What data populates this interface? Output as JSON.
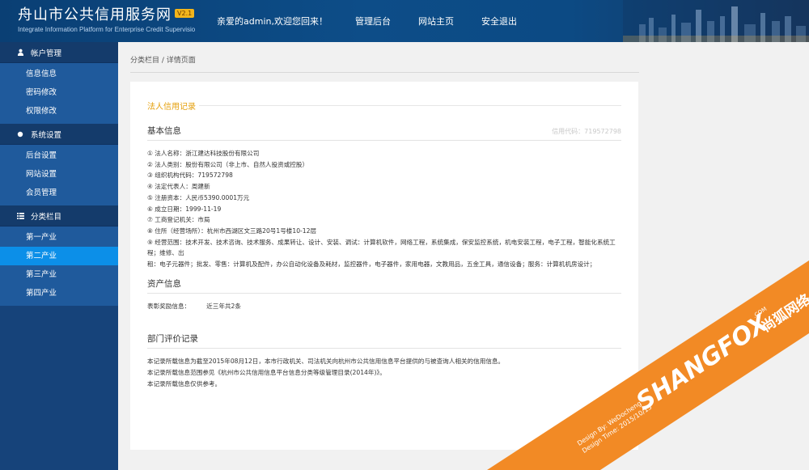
{
  "header": {
    "logo_title": "舟山市公共信用服务网",
    "logo_badge": "V2.1",
    "logo_subtitle": "Integrate Information Platform for Enterprise Credit Supervisio",
    "welcome": "亲爱的admin,欢迎您回来！",
    "nav": [
      "管理后台",
      "网站主页",
      "安全退出"
    ]
  },
  "sidebar": {
    "groups": [
      {
        "label": "帐户管理",
        "icon": "user-icon",
        "items": [
          "信息信息",
          "密码修改",
          "权限修改"
        ]
      },
      {
        "label": "系统设置",
        "icon": "dot-icon",
        "items": [
          "后台设置",
          "网站设置",
          "会员管理"
        ]
      },
      {
        "label": "分类栏目",
        "icon": "list-icon",
        "items": [
          "第一产业",
          "第二产业",
          "第三产业",
          "第四产业"
        ],
        "active_index": 1
      }
    ]
  },
  "breadcrumb": "分类栏目 / 详情页面",
  "record": {
    "title": "法人信用记录",
    "basic_title": "基本信息",
    "credit_code": "信用代码：719572798",
    "basic_rows": [
      "① 法人名称：浙江建达科技股份有限公司",
      "② 法人类别：股份有限公司（非上市、自然人投资或控股）",
      "③ 组织机构代码：719572798",
      "④ 法定代表人：周建新",
      "⑤ 注册资本：人民币5390.0001万元",
      "⑥ 成立日期：1999-11-19",
      "⑦ 工商登记机关：市局",
      "⑧ 住所（经营场所）：杭州市西湖区文三路20号1号楼10-12层",
      "⑨ 经营范围：技术开发、技术咨询、技术服务、成果转让、设计、安装、调试：计算机软件，网络工程，系统集成，保安监控系统，机电安装工程，电子工程，智能化系统工程；维修、出",
      "租：电子元器件；批发、零售：计算机及配件，办公自动化设备及耗材，监控器件，电子器件，家用电器，文教用品，五金工具，通信设备；服务：计算机机房设计；"
    ],
    "asset_title": "资产信息",
    "asset_label": "表彰奖励信息：",
    "asset_value": "近三年共2条",
    "dept_title": "部门评价记录",
    "notes": [
      "本记录所载信息为截至2015年08月12日，本市行政机关、司法机关向杭州市公共信用信息平台提供的与被查询人相关的信用信息。",
      "本记录所载信息范围参见《杭州市公共信用信息平台信息分类等级管理目录(2014年)》。",
      "本记录所载信息仅供参考。"
    ]
  },
  "watermark": {
    "brand": "SHANGFOX",
    "brand_cn": "尚狐网络",
    "dotcom": ".COM",
    "design_by": "Design By: WeDocheng",
    "design_time": "Design Time: 2015/10/15",
    "color": "#f28a25"
  }
}
